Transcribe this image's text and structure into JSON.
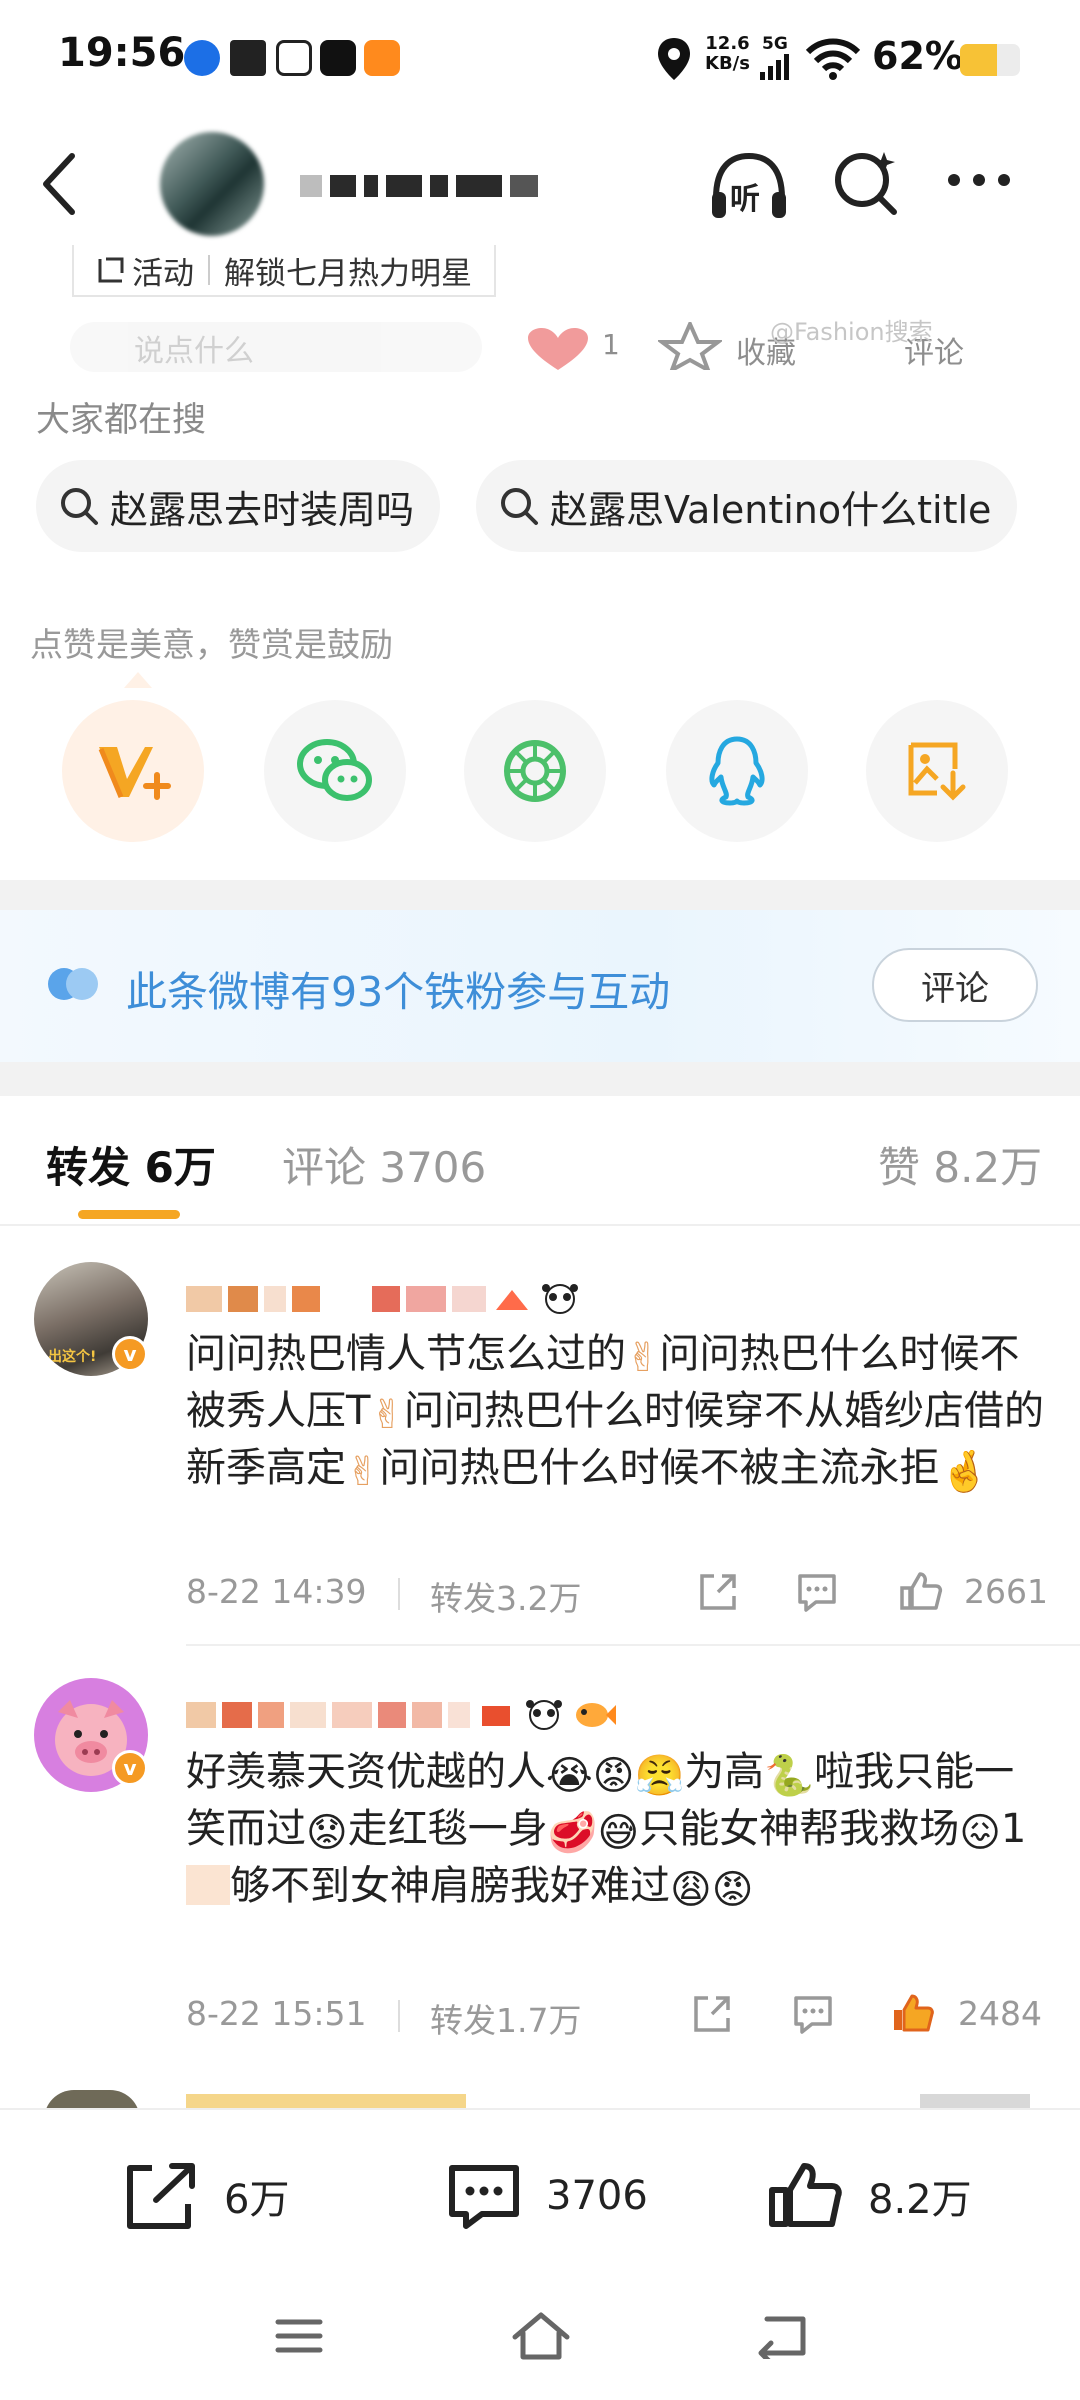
{
  "status_bar": {
    "time": "19:56",
    "net_speed_value": "12.6",
    "net_speed_unit": "KB/s",
    "network": "5G",
    "battery_percent": "62%",
    "battery_level": 0.62
  },
  "header": {
    "listen_label": "听",
    "activity_tag": "活动",
    "activity_text": "解锁七月热力明星"
  },
  "faded_row": {
    "input_placeholder": "说点什么",
    "like_count": "1",
    "favorite_label": "收藏",
    "comment_label": "评论",
    "watermark": "@Fashion搜索"
  },
  "hot_search": {
    "title": "大家都在搜",
    "chips": [
      "赵露思去时装周吗",
      "赵露思Valentino什么title"
    ]
  },
  "reward": {
    "caption": "点赞是美意，赞赏是鼓励",
    "share_icons": [
      "vplus-reward-icon",
      "wechat-icon",
      "moments-icon",
      "qq-icon",
      "save-image-icon"
    ]
  },
  "fans_band": {
    "text": "此条微博有93个铁粉参与互动",
    "button": "评论"
  },
  "tabs": {
    "repost": "转发 6万",
    "comments": "评论 3706",
    "likes": "赞 8.2万"
  },
  "comments": [
    {
      "text_parts": [
        "问问热巴情人节怎么过的",
        "✌",
        "问问热巴什么时候不被秀人压T",
        "✌",
        "问问热巴什么时候穿不从婚纱店借的新季高定",
        "✌",
        "问问热巴什么时候不被主流永拒",
        "🤞"
      ],
      "date": "8-22 14:39",
      "repost": "转发3.2万",
      "likes": "2661"
    },
    {
      "text_parts": [
        "好羡慕天资优越的人",
        "😭",
        "😡",
        "😤",
        "为高",
        "🐍",
        "啦我只能一笑而过",
        "😟",
        "走红毯一身",
        "🥩",
        "😅",
        "只能女神帮我救场",
        "😖",
        "1",
        "够不到女神肩膀我好难过",
        "😩",
        "😡"
      ],
      "date": "8-22 15:51",
      "repost": "转发1.7万",
      "likes": "2484"
    }
  ],
  "bottom_bar": {
    "repost": "6万",
    "comments": "3706",
    "likes": "8.2万"
  },
  "colors": {
    "accent_orange": "#f5a623",
    "fans_blue": "#3e8ed8",
    "wechat_green": "#3cc16d",
    "qq_blue": "#25a8e0"
  }
}
